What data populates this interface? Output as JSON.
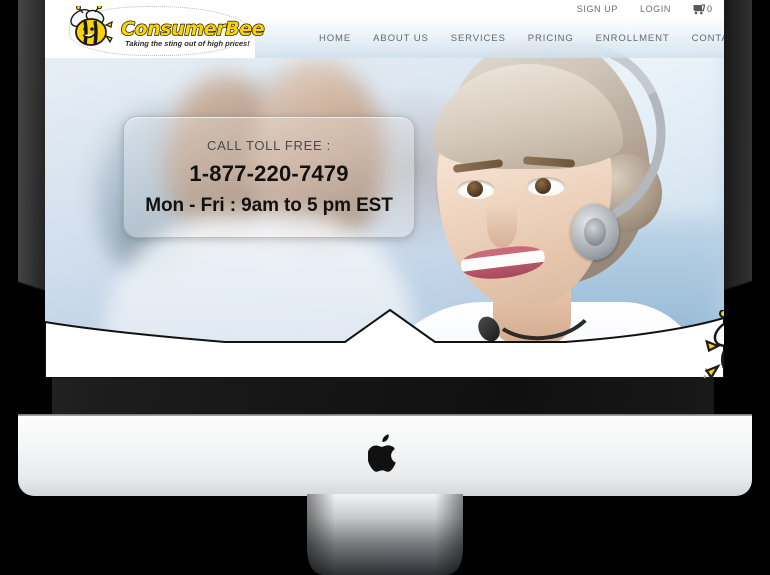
{
  "device": {
    "brand_icon": "apple-logo-icon",
    "type": "imac-desktop-monitor"
  },
  "site": {
    "logo": {
      "name": "ConsumerBee",
      "tagline": "Taking the sting out of high prices!",
      "mark": "bee-icon"
    },
    "topbar": {
      "links": [
        {
          "label": "SIGN UP",
          "name": "sign-up-link"
        },
        {
          "label": "LOGIN",
          "name": "login-link"
        }
      ],
      "cart": {
        "icon": "shopping-cart-icon",
        "count": "0"
      }
    },
    "nav": {
      "items": [
        {
          "label": "HOME"
        },
        {
          "label": "ABOUT US"
        },
        {
          "label": "SERVICES"
        },
        {
          "label": "PRICING"
        },
        {
          "label": "ENROLLMENT"
        },
        {
          "label": "CONTACT US"
        }
      ]
    },
    "hero": {
      "image_alt": "smiling-call-center-agent-with-headset",
      "call_box": {
        "label": "CALL TOLL FREE :",
        "phone": "1-877-220-7479",
        "hours": "Mon - Fri : 9am to 5 pm EST"
      },
      "footer_mark": "bee-icon"
    }
  },
  "colors": {
    "logo_yellow": "#ffd300",
    "logo_outline": "#1a1a1a",
    "nav_text": "#5e6a72",
    "topbar_text": "#6d6d6d",
    "call_text": "#111111",
    "page_background": "#000000",
    "chin_silver": "#f2f3f4"
  }
}
